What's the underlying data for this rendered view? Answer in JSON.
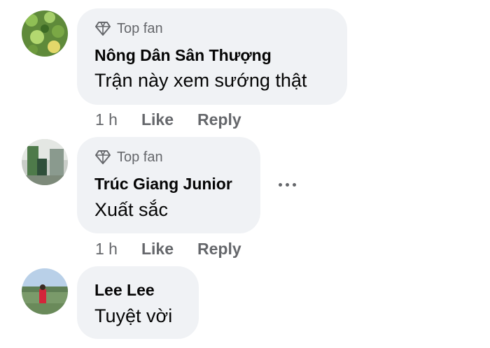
{
  "comments": [
    {
      "badge": "Top fan",
      "author": "Nông Dân Sân Thượng",
      "text": "Trận này xem sướng thật",
      "time": "1 h",
      "like": "Like",
      "reply": "Reply"
    },
    {
      "badge": "Top fan",
      "author": "Trúc Giang Junior",
      "text": "Xuất sắc",
      "time": "1 h",
      "like": "Like",
      "reply": "Reply"
    },
    {
      "author": "Lee Lee",
      "text": "Tuyệt vời"
    }
  ],
  "icons": {
    "badge": "diamond-icon",
    "more": "more-dots-icon"
  },
  "colors": {
    "bubble": "#f0f2f5",
    "secondary_text": "#65676b",
    "primary_text": "#050505"
  }
}
